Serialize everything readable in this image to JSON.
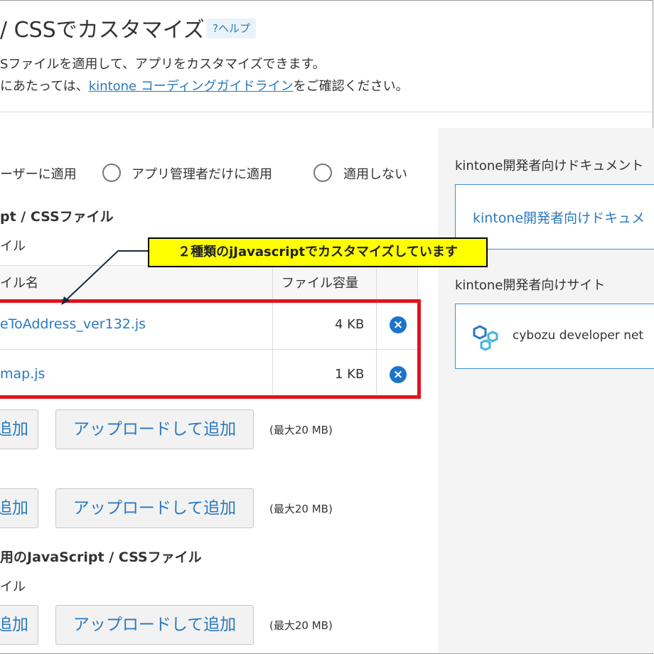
{
  "header": {
    "title": "/ CSSでカスタマイズ",
    "help_label": "?ヘルプ",
    "desc_line1": "Sファイルを適用して、アプリをカスタマイズできます。",
    "desc_line2_prefix": "にあたっては、",
    "desc_link": "kintone コーディングガイドライン",
    "desc_line2_suffix": "をご確認ください。"
  },
  "scope": {
    "options": [
      {
        "label": "ーザーに適用"
      },
      {
        "label": "アプリ管理者だけに適用"
      },
      {
        "label": "適用しない"
      }
    ]
  },
  "pc_section": {
    "title": "pt / CSSファイル",
    "sub": "イル",
    "columns": {
      "name": "イル名",
      "size": "ファイル容量"
    },
    "files": [
      {
        "name": "eToAddress_ver132.js",
        "size": "4 KB"
      },
      {
        "name": "map.js",
        "size": "1 KB"
      }
    ]
  },
  "callout": {
    "text": "２種類のjJavascriptでカスタマイズしています",
    "border_color": "#000000",
    "fill_color": "#ffff00",
    "highlight_color": "#e0141e"
  },
  "buttons": {
    "add_label": "追加",
    "upload_label": "アップロードして追加",
    "max_label": "(最大20 MB)"
  },
  "mobile_section": {
    "title": "用のJavaScript / CSSファイル",
    "sub": "イル"
  },
  "sidebar": {
    "docs_title": "kintone開発者向けドキュメント",
    "docs_link": "kintone開発者向けドキュメ",
    "site_title": "kintone開発者向けサイト",
    "site_logo_text": "cybozu developer net"
  },
  "colors": {
    "accent": "#2a7ac0",
    "delete": "#1d74c8",
    "sidebar_bg": "#f4f4f4"
  },
  "icons": {
    "delete": "close-circle-icon",
    "logo": "cybozu-logo-icon"
  }
}
